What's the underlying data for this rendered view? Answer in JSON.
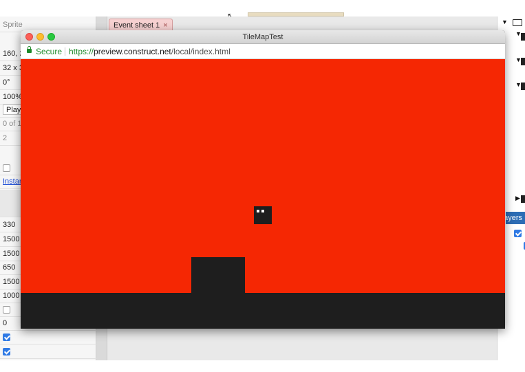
{
  "browser": {
    "title": "TileMapTest",
    "secure_label": "Secure",
    "url_scheme": "https://",
    "url_host": "preview.construct.net",
    "url_path": "/local/index.html"
  },
  "tab": {
    "label": "Event sheet 1",
    "close": "×"
  },
  "left_panel": {
    "rows": [
      {
        "text": "Sprite",
        "style": "gray"
      },
      {
        "text": "160, 2"
      },
      {
        "text": "32 x 3"
      },
      {
        "text": "0°"
      },
      {
        "text": "100%"
      },
      {
        "text": "Playe"
      },
      {
        "text": "0 of 1",
        "style": "gray"
      },
      {
        "text": "2",
        "style": "gray"
      },
      {
        "text": "Instan",
        "style": "link"
      },
      {
        "text": "330"
      },
      {
        "text": "1500"
      },
      {
        "text": "1500"
      },
      {
        "text": "650"
      },
      {
        "text": "1500"
      },
      {
        "text": "1000"
      },
      {
        "text": "0"
      }
    ]
  },
  "right_panel": {
    "layers_label": "Layers"
  },
  "colors": {
    "game_background": "#f52703",
    "tiles": "#1e1e1e",
    "secure_green": "#1d8a2a",
    "layers_header": "#2d6db5",
    "tab_background": "#f6d1d1"
  },
  "icons": {
    "lock": "lock-icon",
    "close": "close-icon",
    "folder": "folder-icon",
    "triangle": "triangle-icon"
  }
}
